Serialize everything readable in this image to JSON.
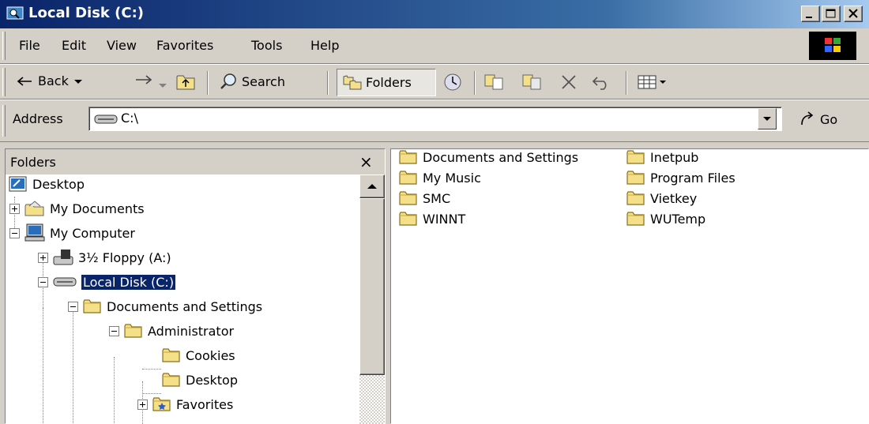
{
  "window": {
    "title": "Local Disk (C:)"
  },
  "menu": [
    "File",
    "Edit",
    "View",
    "Favorites",
    "Tools",
    "Help"
  ],
  "toolbar": {
    "back": "Back",
    "search": "Search",
    "folders": "Folders"
  },
  "address": {
    "label": "Address",
    "value": "C:\\",
    "go": "Go"
  },
  "folders_pane": {
    "header": "Folders",
    "close": "×",
    "tree": [
      "Desktop",
      "My Documents",
      "My Computer",
      "3½ Floppy (A:)",
      "Local Disk (C:)",
      "Documents and Settings",
      "Administrator",
      "Cookies",
      "Desktop",
      "Favorites"
    ]
  },
  "contents": {
    "col1": [
      "Documents and Settings",
      "My Music",
      "SMC",
      "WINNT"
    ],
    "col2": [
      "Inetpub",
      "Program Files",
      "Vietkey",
      "WUTemp"
    ]
  },
  "colors": {
    "title_start": "#0a246a",
    "title_end": "#a6caf0",
    "chrome": "#d4d0c8",
    "selection": "#0a246a",
    "folder": "#f5e08a"
  }
}
